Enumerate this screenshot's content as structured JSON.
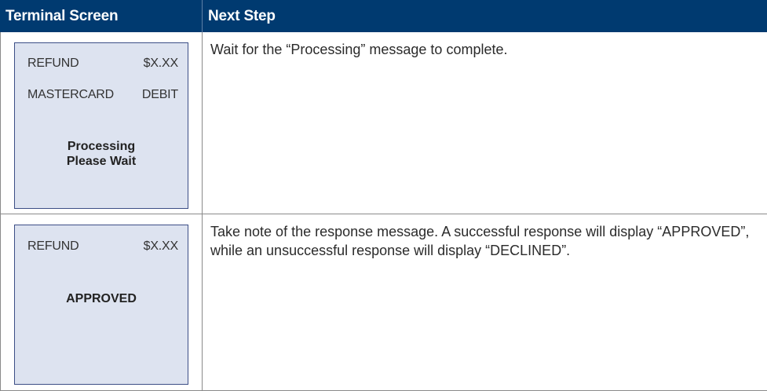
{
  "table": {
    "headers": {
      "terminal_screen": "Terminal Screen",
      "next_step": "Next Step"
    },
    "rows": [
      {
        "screen": {
          "line1_left": "REFUND",
          "line1_right": "$X.XX",
          "line2_left": "MASTERCARD",
          "line2_right": "DEBIT",
          "message_line1": "Processing",
          "message_line2": "Please Wait"
        },
        "next_step": "Wait for the “Processing” message to complete."
      },
      {
        "screen": {
          "line1_left": "REFUND",
          "line1_right": "$X.XX",
          "message_line1": "APPROVED"
        },
        "next_step": "Take note of the response message. A successful response will display “APPROVED”, while an unsuccessful response will display “DECLINED”."
      }
    ]
  },
  "colors": {
    "header_bg": "#003A70",
    "screen_bg": "#dde3f0",
    "screen_border": "#3c4e86"
  }
}
